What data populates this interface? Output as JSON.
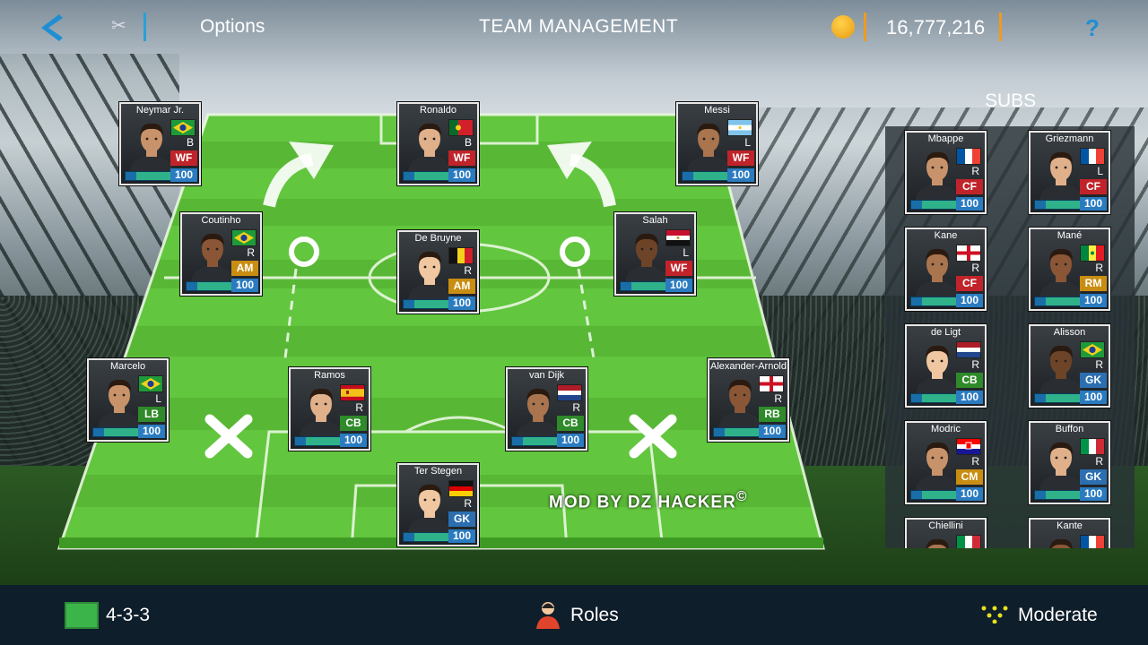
{
  "header": {
    "options_label": "Options",
    "title": "TEAM MANAGEMENT",
    "coins": "16,777,216",
    "help_label": "?"
  },
  "subs_title": "SUBS",
  "watermark": "MOD BY DZ HACKER",
  "watermark_symbol": "©",
  "colors": {
    "pitch": "#5fc23c",
    "accent": "#2aa0d8",
    "coin": "#f0a020"
  },
  "starters": [
    {
      "name": "Neymar Jr.",
      "foot": "B",
      "pos": "WF",
      "rating": "100",
      "flag": "brazil",
      "color": "FW"
    },
    {
      "name": "Ronaldo",
      "foot": "B",
      "pos": "WF",
      "rating": "100",
      "flag": "portugal",
      "color": "FW"
    },
    {
      "name": "Messi",
      "foot": "L",
      "pos": "WF",
      "rating": "100",
      "flag": "argentina",
      "color": "FW"
    },
    {
      "name": "Coutinho",
      "foot": "R",
      "pos": "AM",
      "rating": "100",
      "flag": "brazil",
      "color": "AM"
    },
    {
      "name": "De Bruyne",
      "foot": "R",
      "pos": "AM",
      "rating": "100",
      "flag": "belgium",
      "color": "AM"
    },
    {
      "name": "Salah",
      "foot": "L",
      "pos": "WF",
      "rating": "100",
      "flag": "egypt",
      "color": "FW"
    },
    {
      "name": "Marcelo",
      "foot": "L",
      "pos": "LB",
      "rating": "100",
      "flag": "brazil",
      "color": "DF"
    },
    {
      "name": "Ramos",
      "foot": "R",
      "pos": "CB",
      "rating": "100",
      "flag": "spain",
      "color": "DF"
    },
    {
      "name": "van Dijk",
      "foot": "R",
      "pos": "CB",
      "rating": "100",
      "flag": "netherlands",
      "color": "DF"
    },
    {
      "name": "Alexander-Arnold",
      "foot": "R",
      "pos": "RB",
      "rating": "100",
      "flag": "england",
      "color": "DF"
    },
    {
      "name": "Ter Stegen",
      "foot": "R",
      "pos": "GK",
      "rating": "100",
      "flag": "germany",
      "color": "GK"
    }
  ],
  "subs": [
    {
      "name": "Mbappe",
      "foot": "R",
      "pos": "CF",
      "rating": "100",
      "flag": "france",
      "color": "FW"
    },
    {
      "name": "Griezmann",
      "foot": "L",
      "pos": "CF",
      "rating": "100",
      "flag": "france",
      "color": "FW"
    },
    {
      "name": "Kane",
      "foot": "R",
      "pos": "CF",
      "rating": "100",
      "flag": "england",
      "color": "FW"
    },
    {
      "name": "Mané",
      "foot": "R",
      "pos": "RM",
      "rating": "100",
      "flag": "senegal",
      "color": "AM"
    },
    {
      "name": "de Ligt",
      "foot": "R",
      "pos": "CB",
      "rating": "100",
      "flag": "netherlands",
      "color": "DF"
    },
    {
      "name": "Alisson",
      "foot": "R",
      "pos": "GK",
      "rating": "100",
      "flag": "brazil",
      "color": "GK"
    },
    {
      "name": "Modric",
      "foot": "R",
      "pos": "CM",
      "rating": "100",
      "flag": "croatia",
      "color": "AM"
    },
    {
      "name": "Buffon",
      "foot": "R",
      "pos": "GK",
      "rating": "100",
      "flag": "italy",
      "color": "GK"
    },
    {
      "name": "Chiellini",
      "foot": "",
      "pos": "",
      "rating": "",
      "flag": "italy",
      "color": "DF"
    },
    {
      "name": "Kante",
      "foot": "",
      "pos": "",
      "rating": "",
      "flag": "france",
      "color": "AM"
    }
  ],
  "footer": {
    "formation": "4-3-3",
    "roles_label": "Roles",
    "mentality": "Moderate"
  }
}
